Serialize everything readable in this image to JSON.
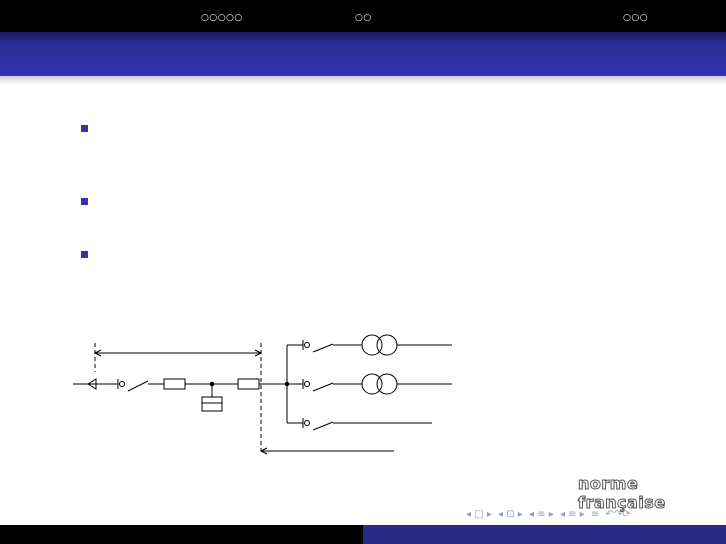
{
  "header": {
    "section_1_dots": "○○○○○",
    "section_2_dots": "○○",
    "section_3_dots": "○○○"
  },
  "logo": {
    "text": "norme française"
  },
  "nav_icons": {
    "prev_frame": "◂ □ ▸",
    "prev_subsection": "◂ ⊡ ▸",
    "section": "◂ ≡ ▸",
    "subsection": "◂ ≡ ▸",
    "align": "≡",
    "search": "↶↷⟳"
  },
  "colors": {
    "title_bar": "#3333b2",
    "bullet": "#3333b2",
    "footer_right": "#2a2a86",
    "top_bar": "#000000"
  }
}
